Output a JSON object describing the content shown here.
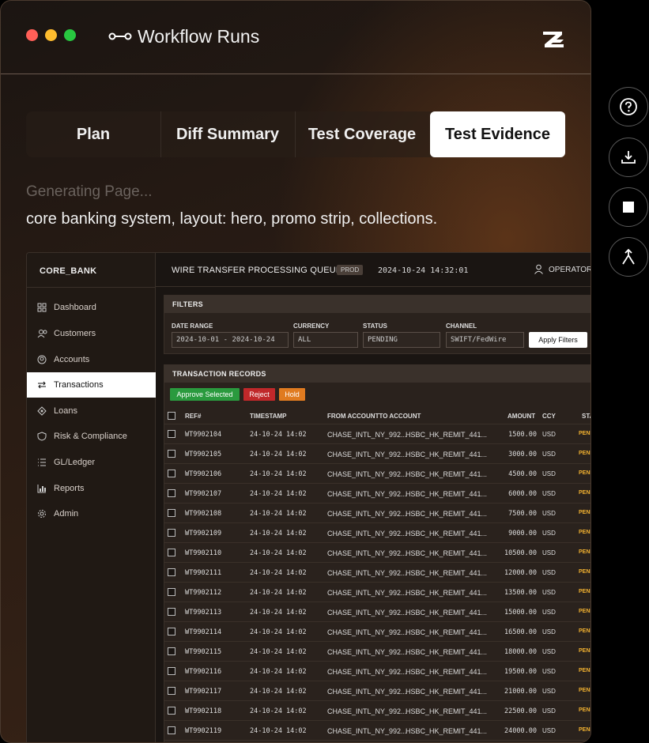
{
  "window": {
    "title": "Workflow Runs"
  },
  "tabs": [
    {
      "label": "Plan"
    },
    {
      "label": "Diff Summary"
    },
    {
      "label": "Test Coverage"
    },
    {
      "label": "Test Evidence",
      "active": true
    }
  ],
  "status_text": "Generating Page...",
  "prompt_text": "core banking system, layout: hero, promo strip, collections.",
  "app": {
    "brand": "CORE_BANK",
    "nav": [
      {
        "label": "Dashboard",
        "icon": "dashboard-icon"
      },
      {
        "label": "Customers",
        "icon": "users-icon"
      },
      {
        "label": "Accounts",
        "icon": "account-icon"
      },
      {
        "label": "Transactions",
        "icon": "transfer-arrows-icon",
        "active": true
      },
      {
        "label": "Loans",
        "icon": "loan-icon"
      },
      {
        "label": "Risk & Compliance",
        "icon": "shield-icon"
      },
      {
        "label": "GL/Ledger",
        "icon": "list-icon"
      },
      {
        "label": "Reports",
        "icon": "chart-icon"
      },
      {
        "label": "Admin",
        "icon": "gear-icon"
      }
    ],
    "topbar": {
      "title": "WIRE TRANSFER PROCESSING QUEUE",
      "env": "PROD",
      "time": "2024-10-24 14:32:01",
      "user": "OPERATOR_"
    },
    "filters": {
      "title": "FILTERS",
      "date_label": "DATE RANGE",
      "date_value": "2024-10-01 - 2024-10-24",
      "currency_label": "CURRENCY",
      "currency_value": "ALL",
      "status_label": "STATUS",
      "status_value": "PENDING",
      "channel_label": "CHANNEL",
      "channel_value": "SWIFT/FedWire",
      "apply_label": "Apply Filters"
    },
    "records": {
      "title": "TRANSACTION RECORDS",
      "approve_label": "Approve Selected",
      "reject_label": "Reject",
      "hold_label": "Hold",
      "headers": {
        "ref": "REF#",
        "timestamp": "TIMESTAMP",
        "from_to": "FROM ACCOUNTTO ACCOUNT",
        "amount": "AMOUNT",
        "ccy": "CCY",
        "status": "STA"
      },
      "rows": [
        {
          "ref": "WT9902104",
          "ts": "24-10-24 14:02",
          "from": "CHASE_INTL_NY_992...",
          "to": "HSBC_HK_REMIT_441...",
          "amount": "1500.00",
          "ccy": "USD",
          "status": "PENI"
        },
        {
          "ref": "WT9902105",
          "ts": "24-10-24 14:02",
          "from": "CHASE_INTL_NY_992...",
          "to": "HSBC_HK_REMIT_441...",
          "amount": "3000.00",
          "ccy": "USD",
          "status": "PENI"
        },
        {
          "ref": "WT9902106",
          "ts": "24-10-24 14:02",
          "from": "CHASE_INTL_NY_992...",
          "to": "HSBC_HK_REMIT_441...",
          "amount": "4500.00",
          "ccy": "USD",
          "status": "PENI"
        },
        {
          "ref": "WT9902107",
          "ts": "24-10-24 14:02",
          "from": "CHASE_INTL_NY_992...",
          "to": "HSBC_HK_REMIT_441...",
          "amount": "6000.00",
          "ccy": "USD",
          "status": "PENI"
        },
        {
          "ref": "WT9902108",
          "ts": "24-10-24 14:02",
          "from": "CHASE_INTL_NY_992...",
          "to": "HSBC_HK_REMIT_441...",
          "amount": "7500.00",
          "ccy": "USD",
          "status": "PENI"
        },
        {
          "ref": "WT9902109",
          "ts": "24-10-24 14:02",
          "from": "CHASE_INTL_NY_992...",
          "to": "HSBC_HK_REMIT_441...",
          "amount": "9000.00",
          "ccy": "USD",
          "status": "PENI"
        },
        {
          "ref": "WT9902110",
          "ts": "24-10-24 14:02",
          "from": "CHASE_INTL_NY_992...",
          "to": "HSBC_HK_REMIT_441...",
          "amount": "10500.00",
          "ccy": "USD",
          "status": "PENI"
        },
        {
          "ref": "WT9902111",
          "ts": "24-10-24 14:02",
          "from": "CHASE_INTL_NY_992...",
          "to": "HSBC_HK_REMIT_441...",
          "amount": "12000.00",
          "ccy": "USD",
          "status": "PENI"
        },
        {
          "ref": "WT9902112",
          "ts": "24-10-24 14:02",
          "from": "CHASE_INTL_NY_992...",
          "to": "HSBC_HK_REMIT_441...",
          "amount": "13500.00",
          "ccy": "USD",
          "status": "PENI"
        },
        {
          "ref": "WT9902113",
          "ts": "24-10-24 14:02",
          "from": "CHASE_INTL_NY_992...",
          "to": "HSBC_HK_REMIT_441...",
          "amount": "15000.00",
          "ccy": "USD",
          "status": "PENI"
        },
        {
          "ref": "WT9902114",
          "ts": "24-10-24 14:02",
          "from": "CHASE_INTL_NY_992...",
          "to": "HSBC_HK_REMIT_441...",
          "amount": "16500.00",
          "ccy": "USD",
          "status": "PENI"
        },
        {
          "ref": "WT9902115",
          "ts": "24-10-24 14:02",
          "from": "CHASE_INTL_NY_992...",
          "to": "HSBC_HK_REMIT_441...",
          "amount": "18000.00",
          "ccy": "USD",
          "status": "PENI"
        },
        {
          "ref": "WT9902116",
          "ts": "24-10-24 14:02",
          "from": "CHASE_INTL_NY_992...",
          "to": "HSBC_HK_REMIT_441...",
          "amount": "19500.00",
          "ccy": "USD",
          "status": "PENI"
        },
        {
          "ref": "WT9902117",
          "ts": "24-10-24 14:02",
          "from": "CHASE_INTL_NY_992...",
          "to": "HSBC_HK_REMIT_441...",
          "amount": "21000.00",
          "ccy": "USD",
          "status": "PENI"
        },
        {
          "ref": "WT9902118",
          "ts": "24-10-24 14:02",
          "from": "CHASE_INTL_NY_992...",
          "to": "HSBC_HK_REMIT_441...",
          "amount": "22500.00",
          "ccy": "USD",
          "status": "PENI"
        },
        {
          "ref": "WT9902119",
          "ts": "24-10-24 14:02",
          "from": "CHASE_INTL_NY_992...",
          "to": "HSBC_HK_REMIT_441...",
          "amount": "24000.00",
          "ccy": "USD",
          "status": "PENI"
        }
      ]
    }
  },
  "side_buttons": [
    {
      "icon": "help-icon"
    },
    {
      "icon": "download-icon"
    },
    {
      "icon": "stop-icon"
    },
    {
      "icon": "merge-icon"
    }
  ],
  "colors": {
    "approve": "#2a9a3e",
    "reject": "#c0282a",
    "hold": "#e07b20",
    "status_pending": "#f0b030",
    "traffic_red": "#ff5f57",
    "traffic_yellow": "#febc2e",
    "traffic_green": "#28c840"
  }
}
